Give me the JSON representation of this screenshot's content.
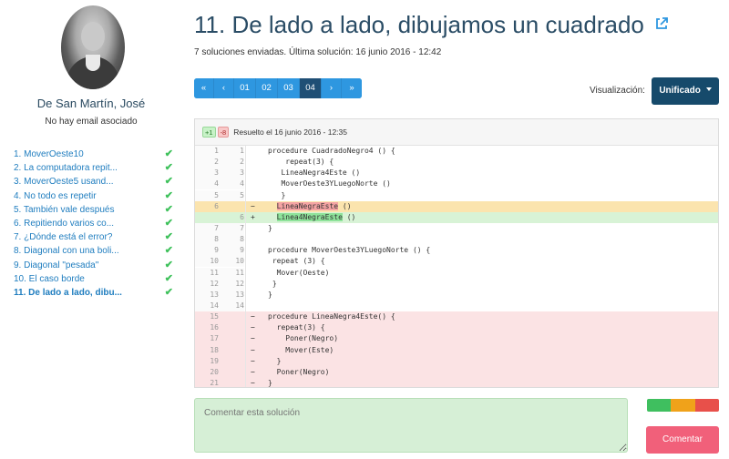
{
  "user": {
    "name": "De San Martín, José",
    "email_status": "No hay email asociado"
  },
  "exercises": [
    {
      "label": "1. MoverOeste10",
      "completed": true,
      "active": false
    },
    {
      "label": "2. La computadora repit...",
      "completed": true,
      "active": false
    },
    {
      "label": "3. MoverOeste5 usand...",
      "completed": true,
      "active": false
    },
    {
      "label": "4. No todo es repetir",
      "completed": true,
      "active": false
    },
    {
      "label": "5. También vale después",
      "completed": true,
      "active": false
    },
    {
      "label": "6. Repitiendo varios co...",
      "completed": true,
      "active": false
    },
    {
      "label": "7. ¿Dónde está el error?",
      "completed": true,
      "active": false
    },
    {
      "label": "8. Diagonal con una boli...",
      "completed": true,
      "active": false
    },
    {
      "label": "9. Diagonal \"pesada\"",
      "completed": true,
      "active": false
    },
    {
      "label": "10. El caso borde",
      "completed": true,
      "active": false
    },
    {
      "label": "11. De lado a lado, dibu...",
      "completed": true,
      "active": true
    }
  ],
  "check_glyph": "✔",
  "exercise": {
    "title": "11. De lado a lado, dibujamos un cuadrado",
    "submissions_info": "7 soluciones enviadas. Última solución: 16 junio 2016 - 12:42"
  },
  "pager": {
    "first": "«",
    "prev": "‹",
    "pages": [
      "01",
      "02",
      "03",
      "04"
    ],
    "active_page": "04",
    "next": "›",
    "last": "»"
  },
  "view": {
    "label": "Visualización:",
    "mode": "Unificado"
  },
  "diff": {
    "additions": "+1",
    "deletions": "-8",
    "resolved_text": "Resuelto el 16 junio 2016 - 12:35",
    "lines": [
      {
        "old": "1",
        "new": "1",
        "sign": "",
        "kind": "ctx",
        "code": "procedure CuadradoNegro4 () {"
      },
      {
        "old": "2",
        "new": "2",
        "sign": "",
        "kind": "ctx",
        "code": "    repeat(3) {"
      },
      {
        "old": "3",
        "new": "3",
        "sign": "",
        "kind": "ctx",
        "code": "   LineaNegra4Este ()"
      },
      {
        "old": "4",
        "new": "4",
        "sign": "",
        "kind": "ctx",
        "code": "   MoverOeste3YLuegoNorte ()"
      },
      {
        "old": "5",
        "new": "5",
        "sign": "",
        "kind": "ctx",
        "code": "   }"
      },
      {
        "old": "6",
        "new": "",
        "sign": "−",
        "kind": "chg-del",
        "pre": "  ",
        "hl": "LineaNegraEste",
        "post": " ()"
      },
      {
        "old": "",
        "new": "6",
        "sign": "+",
        "kind": "chg-add",
        "pre": "  ",
        "hl": "Linea4NegraEste",
        "post": " ()"
      },
      {
        "old": "7",
        "new": "7",
        "sign": "",
        "kind": "ctx",
        "code": "}"
      },
      {
        "old": "8",
        "new": "8",
        "sign": "",
        "kind": "ctx",
        "code": ""
      },
      {
        "old": "9",
        "new": "9",
        "sign": "",
        "kind": "ctx",
        "code": "procedure MoverOeste3YLuegoNorte () {"
      },
      {
        "old": "10",
        "new": "10",
        "sign": "",
        "kind": "ctx",
        "code": " repeat (3) {"
      },
      {
        "old": "11",
        "new": "11",
        "sign": "",
        "kind": "ctx",
        "code": "  Mover(Oeste)"
      },
      {
        "old": "12",
        "new": "12",
        "sign": "",
        "kind": "ctx",
        "code": " }"
      },
      {
        "old": "13",
        "new": "13",
        "sign": "",
        "kind": "ctx",
        "code": "}"
      },
      {
        "old": "14",
        "new": "14",
        "sign": "",
        "kind": "ctx",
        "code": ""
      },
      {
        "old": "15",
        "new": "",
        "sign": "−",
        "kind": "del",
        "code": "procedure LineaNegra4Este() {"
      },
      {
        "old": "16",
        "new": "",
        "sign": "−",
        "kind": "del",
        "code": "  repeat(3) {"
      },
      {
        "old": "17",
        "new": "",
        "sign": "−",
        "kind": "del",
        "code": "    Poner(Negro)"
      },
      {
        "old": "18",
        "new": "",
        "sign": "−",
        "kind": "del",
        "code": "    Mover(Este)"
      },
      {
        "old": "19",
        "new": "",
        "sign": "−",
        "kind": "del",
        "code": "  }"
      },
      {
        "old": "20",
        "new": "",
        "sign": "−",
        "kind": "del",
        "code": "  Poner(Negro)"
      },
      {
        "old": "21",
        "new": "",
        "sign": "−",
        "kind": "del",
        "code": "}"
      }
    ]
  },
  "comment": {
    "placeholder": "Comentar esta solución",
    "button": "Comentar",
    "colors": [
      "#3fbf5f",
      "#f0a21a",
      "#e8504a"
    ]
  },
  "colors": {
    "title": "#2b4d66",
    "link": "#1f7dbf",
    "pager": "#2e97e0",
    "pager_active": "#1f4f75",
    "view_button": "#164a6b",
    "comment_button": "#f1607a"
  }
}
